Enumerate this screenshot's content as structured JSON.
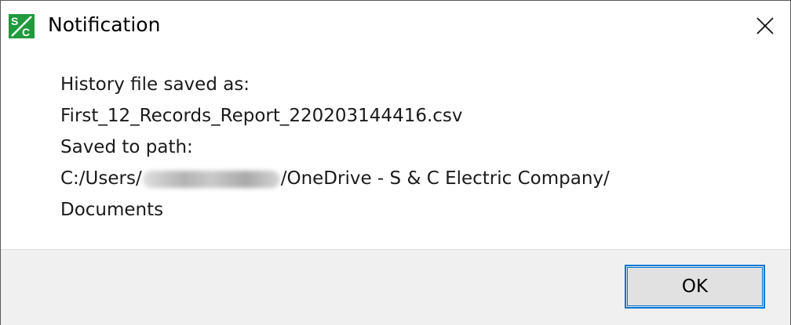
{
  "window": {
    "title": "Notification",
    "app_icon": "sc-logo-icon",
    "close_icon": "close-icon"
  },
  "message": {
    "line1": "History file saved as:",
    "line2": "First_12_Records_Report_220203144416.csv",
    "line3": "Saved to path:",
    "line4_prefix": "C:/Users/",
    "line4_suffix": "/OneDrive - S & C Electric Company/",
    "line5": "Documents"
  },
  "buttons": {
    "ok_label": "OK"
  },
  "colors": {
    "accent": "#0078d7",
    "icon_green": "#1f9a3c",
    "footer_bg": "#f0f0f0"
  }
}
